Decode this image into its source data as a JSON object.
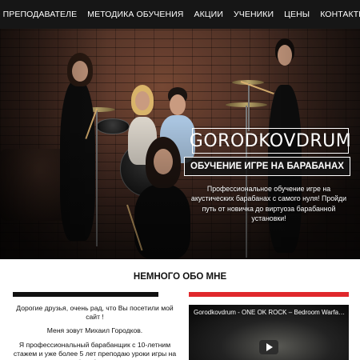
{
  "nav": {
    "items": [
      {
        "label": "О ПРЕПОДАВАТЕЛЕ"
      },
      {
        "label": "МЕТОДИКА ОБУЧЕНИЯ"
      },
      {
        "label": "АКЦИИ"
      },
      {
        "label": "УЧЕНИКИ"
      },
      {
        "label": "ЦЕНЫ"
      },
      {
        "label": "КОНТАКТЫ"
      }
    ]
  },
  "hero": {
    "brand": "GORODKOVDRUM",
    "subtitle": "ОБУЧЕНИЕ ИГРЕ НА БАРАБАНАХ",
    "text": "Профессиональное обучение игре на акустических барабанах с самого нуля! Пройди путь от новичка до виртуоза барабанной установки!"
  },
  "about": {
    "title": "НЕМНОГО ОБО МНЕ",
    "p1": "Дорогие друзья, очень рад, что Вы посетили мой сайт !",
    "p2": "Меня зовут Михаил Городков.",
    "p3": "Я профессиональный барабанщик с 10-летним стажем и уже более 5 лет преподаю уроки игры на барабанах."
  },
  "video": {
    "title": "Gorodkovdrum - ONE OK ROCK – Bedroom Warfare (Drum ..."
  },
  "colors": {
    "nav_bg": "#161616",
    "accent_red": "#e0282c",
    "dark_bar": "#111111"
  }
}
